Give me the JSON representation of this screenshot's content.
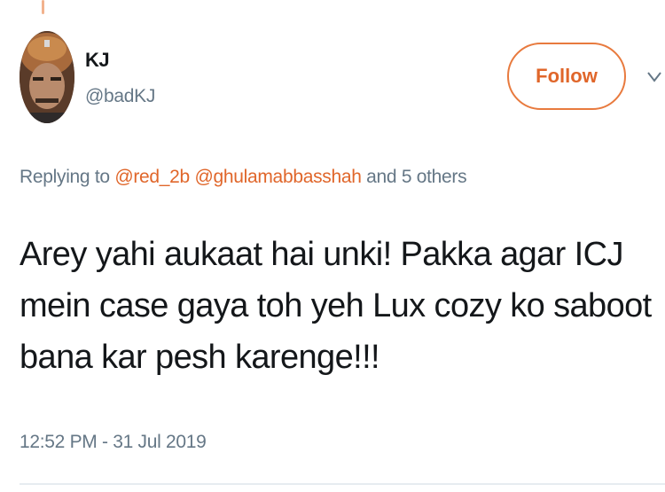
{
  "author": {
    "display_name": "KJ",
    "handle": "@badKJ"
  },
  "follow_label": "Follow",
  "reply_context": {
    "prefix": "Replying to",
    "mentions": [
      "@red_2b",
      "@ghulamabbasshah"
    ],
    "suffix": "and 5 others"
  },
  "tweet": {
    "lines": [
      "Arey yahi aukaat hai unki! Pakka agar ICJ",
      "mein case gaya toh yeh Lux cozy ko saboot",
      "bana kar pesh karenge!!!"
    ],
    "timestamp": "12:52 PM - 31 Jul 2019"
  },
  "colors": {
    "accent": "#e0662a",
    "muted": "#657786",
    "text": "#14171a"
  },
  "icons": {
    "caret": "chevron-down-icon"
  }
}
